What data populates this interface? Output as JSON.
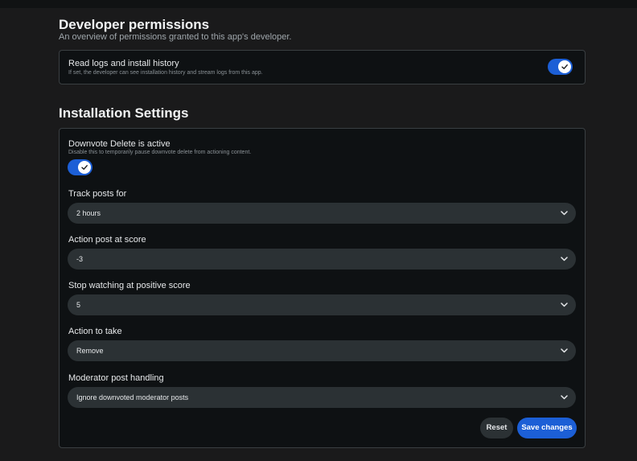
{
  "developer": {
    "title": "Developer permissions",
    "subtitle": "An overview of permissions granted to this app's developer.",
    "logs": {
      "label": "Read logs and install history",
      "description": "If set, the developer can see installation history and stream logs from this app.",
      "enabled": true
    }
  },
  "installation": {
    "title": "Installation Settings",
    "active": {
      "label": "Downvote Delete is active",
      "description": "Disable this to temporarily pause downvote delete from actioning content.",
      "enabled": true
    },
    "fields": [
      {
        "label": "Track posts for",
        "value": "2 hours"
      },
      {
        "label": "Action post at score",
        "value": "-3"
      },
      {
        "label": "Stop watching at positive score",
        "value": "5"
      },
      {
        "label": "Action to take",
        "value": "Remove"
      },
      {
        "label": "Moderator post handling",
        "value": "Ignore downvoted moderator posts"
      }
    ],
    "reset_label": "Reset",
    "save_label": "Save changes"
  },
  "colors": {
    "accent": "#1c5fd6",
    "background": "#1a1a1b",
    "card": "#0e1113",
    "select": "#2b3134"
  },
  "icons": {
    "toggle_check": "check-icon",
    "select_chevron": "chevron-down-icon"
  }
}
